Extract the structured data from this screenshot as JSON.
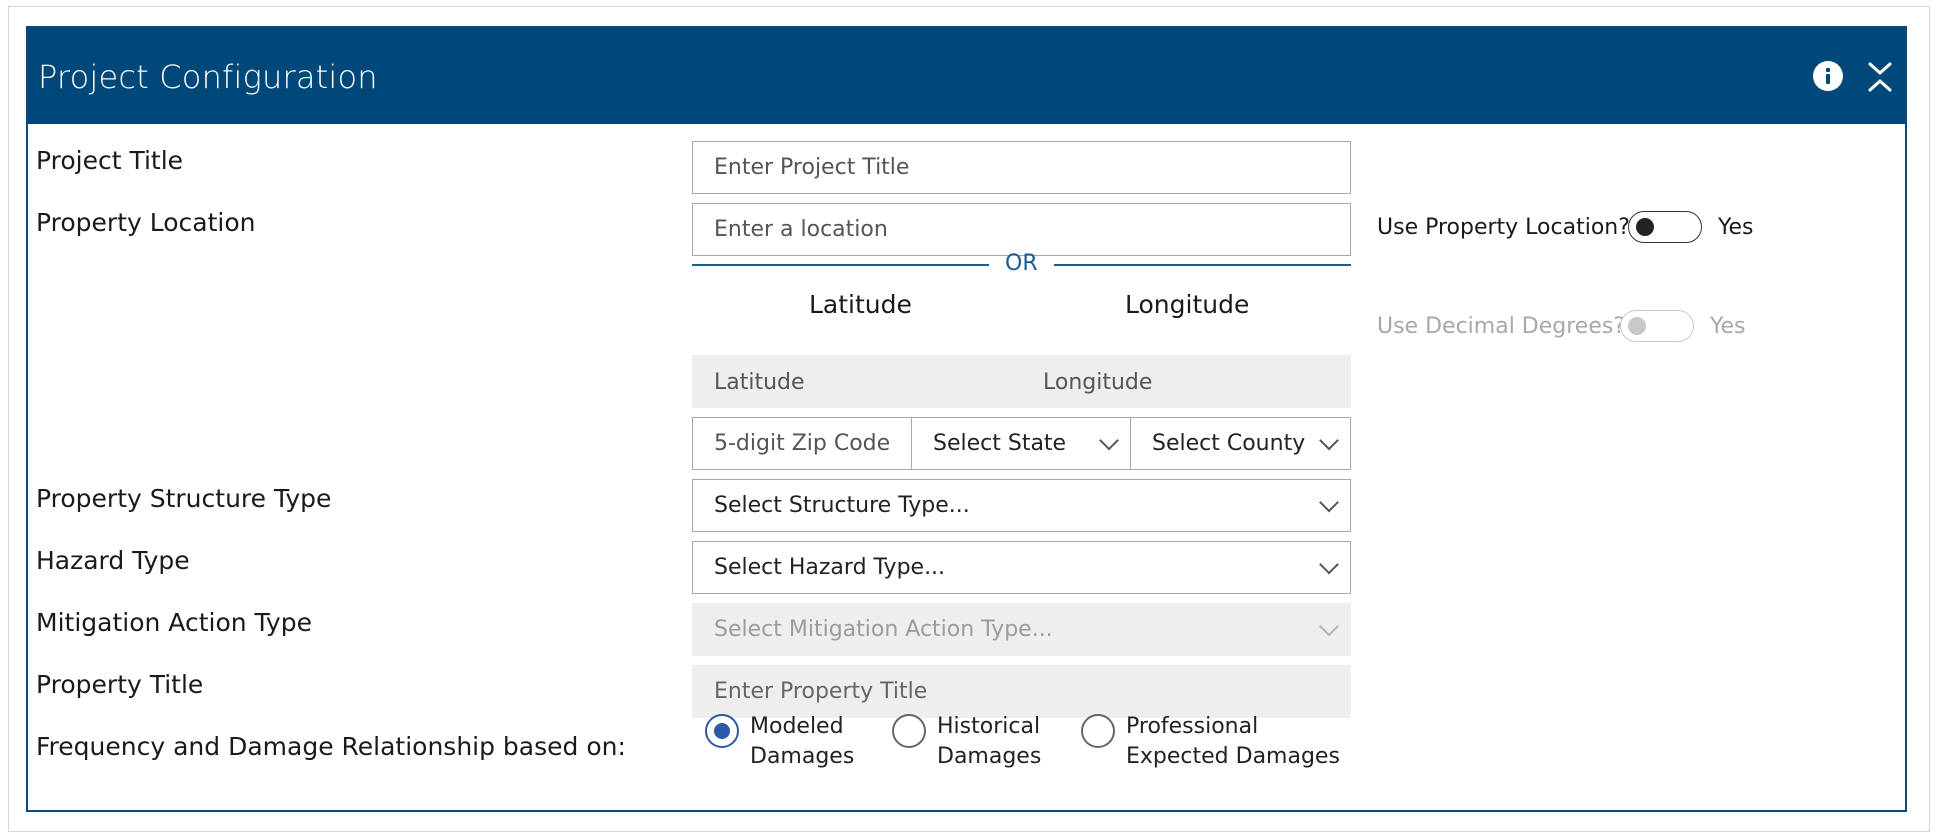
{
  "dialog": {
    "title": "Project Configuration"
  },
  "form": {
    "project_title": {
      "label": "Project Title",
      "placeholder": "Enter Project Title"
    },
    "property_location": {
      "label": "Property Location",
      "placeholder": "Enter a location"
    },
    "or_divider": "OR",
    "latitude": {
      "heading": "Latitude",
      "placeholder": "Latitude"
    },
    "longitude": {
      "heading": "Longitude",
      "placeholder": "Longitude"
    },
    "zip": {
      "placeholder": "5-digit Zip Code"
    },
    "state": {
      "placeholder": "Select State"
    },
    "county": {
      "placeholder": "Select County"
    },
    "structure_type": {
      "label": "Property Structure Type",
      "placeholder": "Select Structure Type..."
    },
    "hazard_type": {
      "label": "Hazard Type",
      "placeholder": "Select Hazard Type..."
    },
    "mitigation_action_type": {
      "label": "Mitigation Action Type",
      "placeholder": "Select Mitigation Action Type..."
    },
    "property_title": {
      "label": "Property Title",
      "placeholder": "Enter Property Title"
    },
    "frequency_damage": {
      "label": "Frequency and Damage Relationship based on:",
      "options": [
        {
          "line1": "Modeled",
          "line2": "Damages",
          "selected": true
        },
        {
          "line1": "Historical",
          "line2": "Damages",
          "selected": false
        },
        {
          "line1": "Professional",
          "line2": "Expected Damages",
          "selected": false
        }
      ]
    }
  },
  "toggles": {
    "use_property_location": {
      "label": "Use Property Location?",
      "state_text": "Yes",
      "enabled": true,
      "on": false
    },
    "use_decimal_degrees": {
      "label": "Use Decimal Degrees?",
      "state_text": "Yes",
      "enabled": false,
      "on": false
    }
  },
  "colors": {
    "header_bg": "#004879",
    "accent": "#1a5c94",
    "radio_selected": "#2b5aa8",
    "disabled_bg": "#eeeeee"
  },
  "icons": {
    "header_right": [
      "info-icon",
      "collapse-icon"
    ],
    "select_indicator": "chevron-down-icon"
  }
}
